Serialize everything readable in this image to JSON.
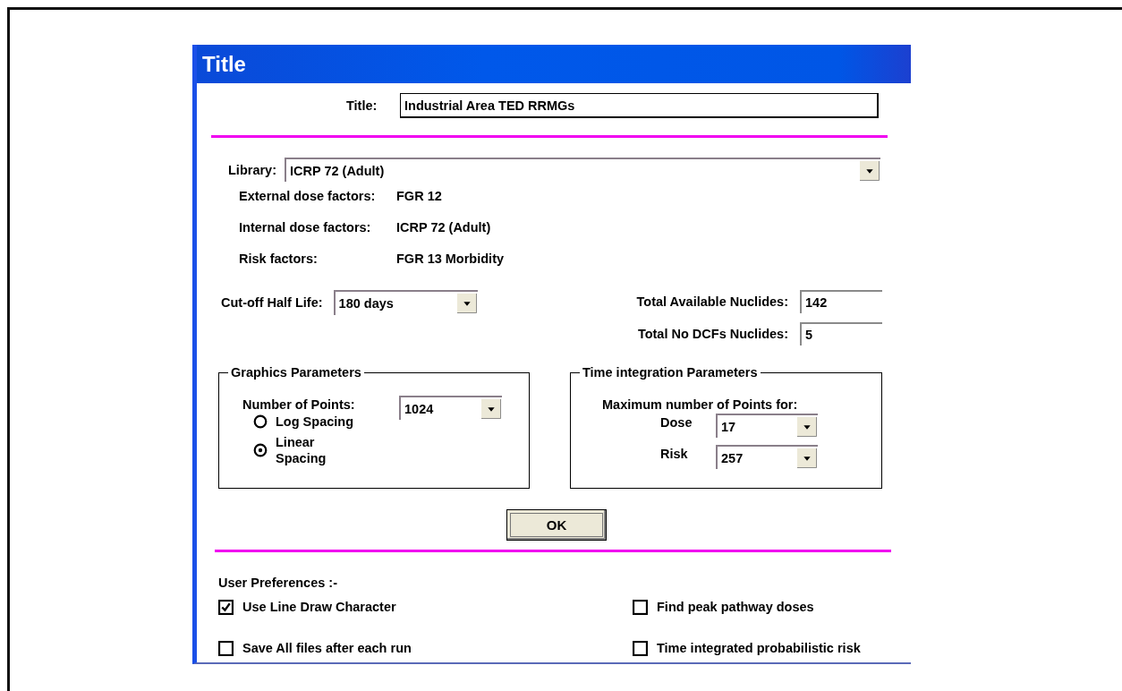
{
  "window": {
    "title": "Title"
  },
  "title_field": {
    "label": "Title:",
    "value": "Industrial Area TED RRMGs"
  },
  "library": {
    "label": "Library:",
    "value": "ICRP 72 (Adult)"
  },
  "factors": [
    {
      "label": "External dose factors:",
      "value": "FGR 12"
    },
    {
      "label": "Internal dose factors:",
      "value": "ICRP 72 (Adult)"
    },
    {
      "label": "Risk factors:",
      "value": "FGR 13 Morbidity"
    }
  ],
  "cutoff": {
    "label": "Cut-off Half Life:",
    "value": "180 days"
  },
  "totals": [
    {
      "label": "Total Available Nuclides:",
      "value": "142"
    },
    {
      "label": "Total No DCFs Nuclides:",
      "value": "5"
    }
  ],
  "graphics": {
    "title": "Graphics Parameters",
    "points_label": "Number of Points:",
    "points_value": "1024",
    "options": [
      {
        "label": "Log Spacing",
        "selected": false
      },
      {
        "label": "Linear Spacing",
        "selected": true
      }
    ]
  },
  "time_integration": {
    "title": "Time integration Parameters",
    "heading": "Maximum number of Points for:",
    "rows": [
      {
        "label": "Dose",
        "value": "17"
      },
      {
        "label": "Risk",
        "value": "257"
      }
    ]
  },
  "ok_button": "OK",
  "preferences": {
    "heading": "User  Preferences :-",
    "options": [
      {
        "label": "Use Line Draw Character",
        "checked": true
      },
      {
        "label": "Find peak pathway doses",
        "checked": false
      },
      {
        "label": "Save All files after each run",
        "checked": false
      },
      {
        "label": "Time integrated probabilistic risk",
        "checked": false
      }
    ]
  }
}
